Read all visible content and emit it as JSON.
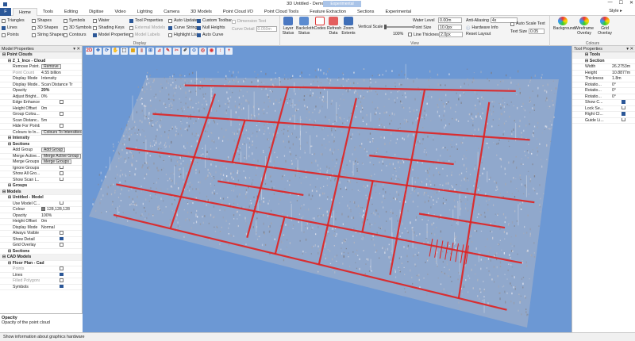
{
  "window": {
    "title": "3D Untitled - DemoProdit - toko",
    "context_tab": "Experimental",
    "min": "—",
    "max": "☐",
    "close": "✕"
  },
  "ribbon_tabs": [
    "Home",
    "Tools",
    "Editing",
    "Digitise",
    "Video",
    "Lighting",
    "Camera",
    "3D Models",
    "Point Cloud I/O",
    "Point Cloud Tools",
    "Feature Extraction",
    "Sections",
    "Experimental"
  ],
  "file_tab": "F",
  "style_label": "Style ▸",
  "display_group": {
    "label": "Display",
    "checks": [
      {
        "label": "Triangles",
        "on": false
      },
      {
        "label": "Lines",
        "on": true
      },
      {
        "label": "Points",
        "on": false
      },
      {
        "label": "Shapes",
        "on": false
      },
      {
        "label": "3D Shapes",
        "on": false
      },
      {
        "label": "String Shapes",
        "on": false
      },
      {
        "label": "Symbols",
        "on": false
      },
      {
        "label": "3D Symbols",
        "on": false
      },
      {
        "label": "Contours",
        "on": false
      },
      {
        "label": "Water",
        "on": false
      },
      {
        "label": "Shading Keys",
        "on": false
      },
      {
        "label": "Model Properties",
        "on": true
      },
      {
        "label": "Tool Properties",
        "on": true
      },
      {
        "label": "External Models",
        "on": false
      },
      {
        "label": "Model Labels",
        "on": false
      },
      {
        "label": "Auto Update",
        "on": false
      },
      {
        "label": "Curve Strings",
        "on": true
      },
      {
        "label": "Highlight List",
        "on": false
      },
      {
        "label": "Custom Toolbar",
        "on": true
      },
      {
        "label": "Null Heights",
        "on": true
      },
      {
        "label": "Auto Curve",
        "on": true
      }
    ],
    "dimension_text": "Dimension Text",
    "curve_detail_label": "Curve Detail",
    "curve_detail_value": "0.050m"
  },
  "view_group": {
    "label": "View",
    "buttons": [
      "Layer Status",
      "Backcloth Status",
      "Codes",
      "Refresh Data",
      "Zoom Extents"
    ],
    "vertical_scale_label": "Vertical Scale",
    "vertical_scale_value": "100%",
    "water_level_label": "Water Level",
    "water_level_value": "0.00m",
    "point_size_label": "Point Size",
    "point_size_value": "10.0px",
    "line_thickness_label": "Line Thickness",
    "line_thickness_value": "2.0px",
    "anti_aliasing_label": "Anti-Aliasing",
    "anti_aliasing_value": "4x",
    "hardware_info": "Hardware Info",
    "reset_layout": "Reset Layout",
    "auto_scale_text": "Auto Scale Text",
    "text_size_label": "Text Size",
    "text_size_value": "0.05"
  },
  "colours_group": {
    "label": "Colours",
    "buttons": [
      "Background",
      "Wireframe Overlay",
      "Grid Overlay"
    ]
  },
  "model_properties": {
    "title": "Model Properties",
    "rows": [
      {
        "type": "cat",
        "k": "Point Clouds"
      },
      {
        "type": "sub",
        "k": "Z_1_Ince - Cloud"
      },
      {
        "k": "Remove Point...",
        "btn": "Remove"
      },
      {
        "k": "Point Count",
        "v": "4.55 billion",
        "grey": true
      },
      {
        "k": "Display Mode",
        "v": "Intensity"
      },
      {
        "k": "Display Mode...",
        "v": "Scan Distance Tr"
      },
      {
        "k": "Opacity",
        "v": "20%"
      },
      {
        "k": "Adjust Bright...",
        "v": "0%"
      },
      {
        "k": "Edge Enhance",
        "cb": false
      },
      {
        "k": "Height Offset",
        "v": "0m"
      },
      {
        "k": "Group Colou...",
        "cb": false
      },
      {
        "k": "Scan Distanc...",
        "v": "5m"
      },
      {
        "k": "Hide For Points",
        "cb": false
      },
      {
        "k": "Colours to In...",
        "btn": "Colours To Intensities"
      },
      {
        "type": "sub",
        "k": "Intensity"
      },
      {
        "type": "sub",
        "k": "Sections"
      },
      {
        "k": "Add Group",
        "btn": "Add Group"
      },
      {
        "k": "Merge Active...",
        "btn": "Merge Active Group"
      },
      {
        "k": "Merge Groups",
        "btn": "Merge Groups"
      },
      {
        "k": "Ignore Groups",
        "cb": false
      },
      {
        "k": "Show All Gro...",
        "cb": false
      },
      {
        "k": "Show Scan L...",
        "cb": false
      },
      {
        "type": "sub",
        "k": "Groups"
      },
      {
        "type": "cat",
        "k": "Models"
      },
      {
        "type": "sub",
        "k": "Untitled - Model"
      },
      {
        "k": "Use Model C...",
        "cb": false
      },
      {
        "k": "Colour",
        "v": "128,128,128",
        "swatch": true
      },
      {
        "k": "Opacity",
        "v": "100%"
      },
      {
        "k": "Height Offset",
        "v": "0m"
      },
      {
        "k": "Display Mode",
        "v": "Normal"
      },
      {
        "k": "Always Visible",
        "cb": false
      },
      {
        "k": "Show Detail",
        "cb": true
      },
      {
        "k": "Grid Overlay",
        "cb": false
      },
      {
        "type": "sub",
        "k": "Sections"
      },
      {
        "type": "cat",
        "k": "CAD Models"
      },
      {
        "type": "sub",
        "k": "Floor Plan - Cad"
      },
      {
        "k": "Points",
        "cb": false,
        "grey": true
      },
      {
        "k": "Lines",
        "cb": true
      },
      {
        "k": "Filled Polygons",
        "cb": false,
        "grey": true
      },
      {
        "k": "Symbols",
        "cb": true
      }
    ],
    "desc_title": "Opacity",
    "desc_text": "Opacity of the point cloud"
  },
  "tool_properties": {
    "title": "Tool Properties",
    "rows": [
      {
        "type": "cat",
        "k": "Tools"
      },
      {
        "type": "sub",
        "k": "Section"
      },
      {
        "k": "Width",
        "v": "26.2753m"
      },
      {
        "k": "Height",
        "v": "10.8877m"
      },
      {
        "k": "Thickness",
        "v": "1.8m"
      },
      {
        "k": "Rotatio...",
        "v": "0°"
      },
      {
        "k": "Rotatio...",
        "v": "0°"
      },
      {
        "k": "Rotatio...",
        "v": "0°"
      },
      {
        "k": "Show C...",
        "cb": true
      },
      {
        "k": "Lock Se...",
        "cb": false
      },
      {
        "k": "Right Cl...",
        "cb": true
      },
      {
        "k": "Guide Li...",
        "cb": false
      }
    ]
  },
  "viewport": {
    "toolbar_icons": [
      "2d-view-icon",
      "move-icon",
      "rotate-icon",
      "pan-icon",
      "select-icon",
      "layers-icon",
      "ruler-icon",
      "section-icon",
      "measure-icon",
      "pencil-icon",
      "scissors-icon",
      "tag-icon",
      "camera-icon",
      "target-icon",
      "record-icon",
      "axis-icon",
      "zoom-plus-icon"
    ],
    "toolbar_glyphs": [
      "2D",
      "✥",
      "⟳",
      "✋",
      "⬚",
      "▦",
      "▮",
      "⊞",
      "⊿",
      "✎",
      "✂",
      "✐",
      "⊙",
      "◎",
      "◉",
      "↕",
      "+"
    ],
    "background_color": "#6c98d4",
    "cad_line_color": "#e02020"
  },
  "status_text": "Show information about graphics hardware"
}
